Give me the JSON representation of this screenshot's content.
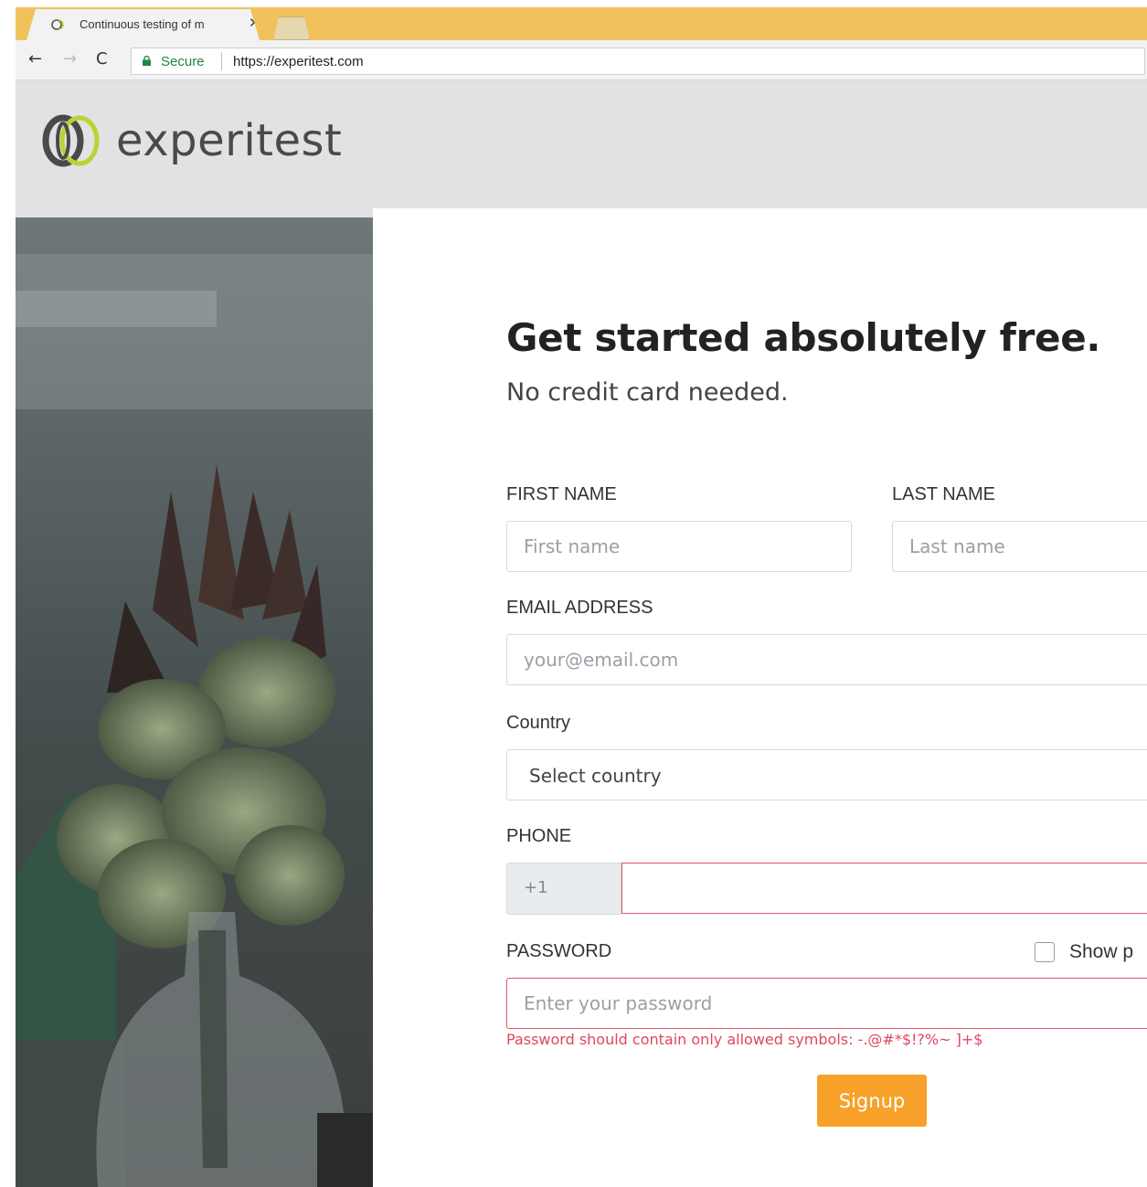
{
  "browser": {
    "tab_title": "Continuous testing of m",
    "tab_close": "✕",
    "nav_back": "←",
    "nav_forward": "→",
    "nav_reload": "C",
    "secure_label": "Secure",
    "url": "https://experitest.com"
  },
  "site": {
    "logo_text": "experitest",
    "brand_colors": {
      "logo_ring_dark": "#4a4a4a",
      "logo_ring_green": "#b8d432"
    }
  },
  "form": {
    "headline": "Get started absolutely free.",
    "subhead": "No credit card needed.",
    "first_name": {
      "label": "FIRST NAME",
      "placeholder": "First name",
      "value": ""
    },
    "last_name": {
      "label": "LAST NAME",
      "placeholder": "Last name",
      "value": ""
    },
    "email": {
      "label": "EMAIL ADDRESS",
      "placeholder": "your@email.com",
      "value": ""
    },
    "country": {
      "label": "Country",
      "selected": "Select country"
    },
    "phone": {
      "label": "PHONE",
      "prefix": "+1",
      "value": ""
    },
    "password": {
      "label": "PASSWORD",
      "placeholder": "Enter your password",
      "value": "",
      "show_password_label": "Show p",
      "show_password_checked": false,
      "error": "Password should contain only allowed symbols: -.@#*$!?%~ ]+$"
    },
    "submit_label": "Signup",
    "colors": {
      "error": "#e0465e",
      "submit": "#f7a12a"
    }
  }
}
